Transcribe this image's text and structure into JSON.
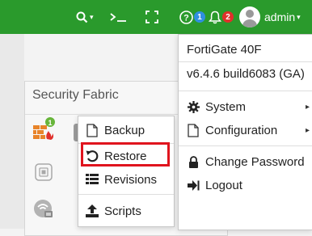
{
  "topbar": {
    "background": "#2a9a2c",
    "search_icon": "search-icon",
    "cli_icon": "cli-icon",
    "fullscreen_icon": "fullscreen-icon",
    "help_badge": "1",
    "alert_badge": "2",
    "username": "admin"
  },
  "panel": {
    "title": "Security Fabric",
    "fortigate_badge": "1"
  },
  "popup_menu": {
    "items": [
      {
        "label": "Backup",
        "icon": "file-icon"
      },
      {
        "label": "Restore",
        "icon": "restore-icon"
      },
      {
        "label": "Revisions",
        "icon": "list-icon"
      },
      {
        "label": "Scripts",
        "icon": "upload-icon"
      }
    ],
    "highlight_color": "#e0141e"
  },
  "admin_menu": {
    "device_name": "FortiGate 40F",
    "firmware": "v6.4.6 build6083 (GA)",
    "system_label": "System",
    "configuration_label": "Configuration",
    "change_password_label": "Change Password",
    "logout_label": "Logout"
  }
}
